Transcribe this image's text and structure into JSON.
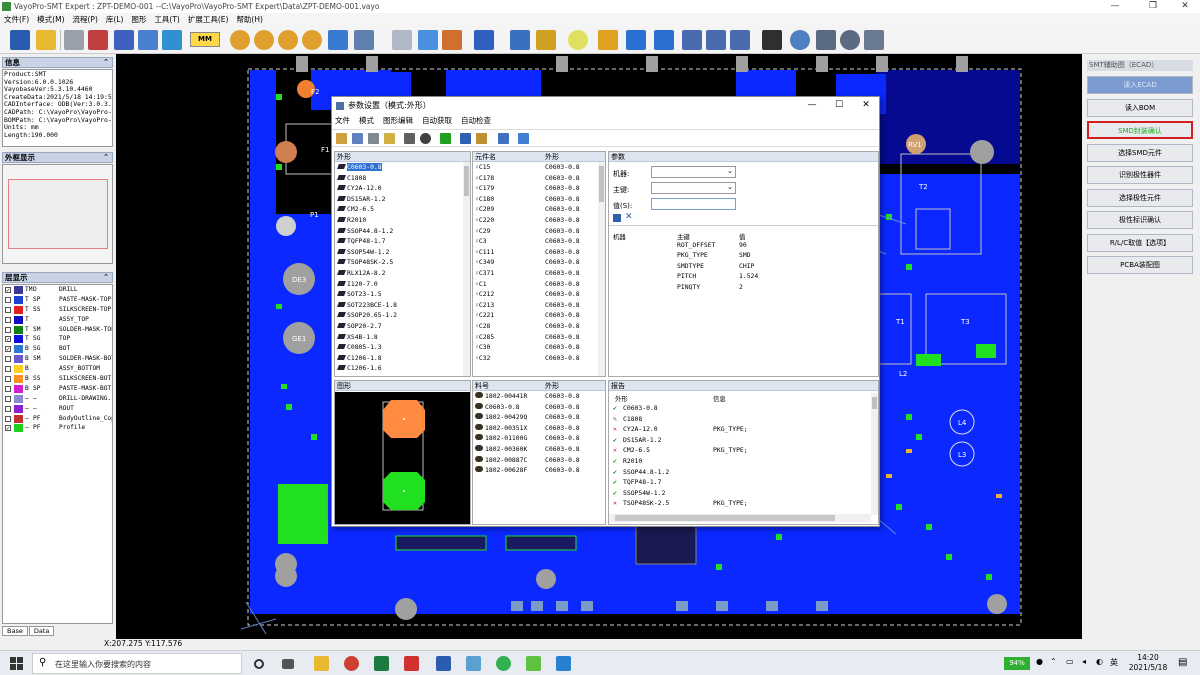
{
  "window": {
    "title": "VayoPro-SMT Expert : ZPT-DEMO-001 --C:\\VayoPro\\VayoPro-SMT Expert\\Data\\ZPT-DEMO-001.vayo"
  },
  "menu": [
    "文件(F)",
    "模式(M)",
    "流程(P)",
    "库(L)",
    "图形",
    "工具(T)",
    "扩展工具(E)",
    "帮助(H)"
  ],
  "toolbar": {
    "unit": "MM"
  },
  "info": {
    "title": "信息",
    "lines": [
      "Product:SMT",
      "Version:6.0.0.1026",
      "VayobaseVer:5.3.10.4460",
      "CreateData:2021/5/18 14:19:52",
      "CADInterface: ODB(Ver:3.0.3.1",
      "CADPath: C:\\VayoPro\\VayoPro-S",
      "BOMPath: C:\\VayoPro\\VayoPro-S",
      "Units: mm",
      "Length:190.000"
    ]
  },
  "overview": {
    "title": "外框显示"
  },
  "layers": {
    "title": "层显示",
    "rows": [
      {
        "on": true,
        "c1": "TM",
        "c2": "D",
        "name": "DRILL",
        "color": "#3a3a9a"
      },
      {
        "on": false,
        "c1": "T",
        "c2": "SP",
        "name": "PASTE-MASK-TOP",
        "color": "#2040d0"
      },
      {
        "on": false,
        "c1": "T",
        "c2": "SS",
        "name": "SILKSCREEN-TOP",
        "color": "#e02020"
      },
      {
        "on": false,
        "c1": "T",
        "c2": "",
        "name": "ASSY_TOP",
        "color": "#1010c0"
      },
      {
        "on": false,
        "c1": "T",
        "c2": "SM",
        "name": "SOLDER-MASK-TOP",
        "color": "#108010"
      },
      {
        "on": true,
        "c1": "T",
        "c2": "SG",
        "name": "TOP",
        "color": "#1010e0"
      },
      {
        "on": true,
        "c1": "B",
        "c2": "SG",
        "name": "BOT",
        "color": "#2a7ad0"
      },
      {
        "on": false,
        "c1": "B",
        "c2": "SM",
        "name": "SOLDER-MASK-BOT",
        "color": "#6a5acd"
      },
      {
        "on": false,
        "c1": "B",
        "c2": "",
        "name": "ASSY_BOTTOM",
        "color": "#ffd020"
      },
      {
        "on": false,
        "c1": "B",
        "c2": "SS",
        "name": "SILKSCREEN-BOT",
        "color": "#ff9020"
      },
      {
        "on": false,
        "c1": "B",
        "c2": "SP",
        "name": "PASTE-MASK-BOT",
        "color": "#d020d0"
      },
      {
        "on": false,
        "c1": "—",
        "c2": "—",
        "name": "DRILL-DRAWING.",
        "color": "#8a8ad0"
      },
      {
        "on": false,
        "c1": "—",
        "c2": "—",
        "name": "ROUT",
        "color": "#8a20d0"
      },
      {
        "on": false,
        "c1": "—",
        "c2": "PF",
        "name": "BodyOutline_Cop",
        "color": "#c03030"
      },
      {
        "on": true,
        "c1": "—",
        "c2": "PF",
        "name": "Profile",
        "color": "#20d020"
      }
    ]
  },
  "bottomTabs": [
    "Base",
    "Data"
  ],
  "status": {
    "coords": "X:207.275 Y:117.576"
  },
  "rightPanel": {
    "title": "SMT辅助图（ECAD）",
    "buttons": [
      "读入ECAD",
      "读入BOM",
      "SMD封装确认",
      "选择SMD元件",
      "识别极性器件",
      "选择极性元件",
      "极性标识确认",
      "R/L/C取值【选项】",
      "PCBA装配图"
    ],
    "active": 2
  },
  "dialog": {
    "title": "参数设置（模式:外形）",
    "menu": [
      "文件",
      "模式",
      "图形编辑",
      "自动获取",
      "自动检查"
    ],
    "shapeHeader": "外形",
    "shapes": [
      "C0603-0.8",
      "C1808",
      "CY2A-12.0",
      "DS15AR-1.2",
      "CM2-6.5",
      "R2010",
      "SSOP44.8-1.2",
      "TQFP48-1.7",
      "SSOP54W-1.2",
      "TSOP48SK-2.5",
      "RLX12A-8.2",
      "I120-7.0",
      "SOT23-1.5",
      "SOT223BCE-1.8",
      "SSOP20.65-1.2",
      "SOP20-2.7",
      "XS4B-1.8",
      "C0805-1.3",
      "C1206-1.8",
      "C1206-1.6"
    ],
    "compHeaders": [
      "元件名",
      "外形"
    ],
    "components": [
      [
        "C15",
        "C0603-0.8"
      ],
      [
        "C178",
        "C0603-0.8"
      ],
      [
        "C179",
        "C0603-0.8"
      ],
      [
        "C180",
        "C0603-0.8"
      ],
      [
        "C209",
        "C0603-0.8"
      ],
      [
        "C220",
        "C0603-0.8"
      ],
      [
        "C29",
        "C0603-0.8"
      ],
      [
        "C3",
        "C0603-0.8"
      ],
      [
        "C111",
        "C0603-0.8"
      ],
      [
        "C349",
        "C0603-0.8"
      ],
      [
        "C371",
        "C0603-0.8"
      ],
      [
        "C1",
        "C0603-0.8"
      ],
      [
        "C212",
        "C0603-0.8"
      ],
      [
        "C213",
        "C0603-0.8"
      ],
      [
        "C221",
        "C0603-0.8"
      ],
      [
        "C28",
        "C0603-0.8"
      ],
      [
        "C285",
        "C0603-0.8"
      ],
      [
        "C30",
        "C0603-0.8"
      ],
      [
        "C32",
        "C0603-0.8"
      ]
    ],
    "paramTitle": "参数",
    "paramLabels": [
      "机器:",
      "主键:",
      "值(S):"
    ],
    "paramHeaders": [
      "机器",
      "主键",
      "值"
    ],
    "params": [
      [
        "ROT_OFFSET",
        "90"
      ],
      [
        "PKG_TYPE",
        "SMD"
      ],
      [
        "SMDTYPE",
        "CHIP"
      ],
      [
        "PITCH",
        "1.524"
      ],
      [
        "PINQTY",
        "2"
      ]
    ],
    "graphicTitle": "图形",
    "partHeaders": [
      "料号",
      "外形"
    ],
    "parts": [
      [
        "1802-00441R",
        "C0603-0.8"
      ],
      [
        "C0603-0.8",
        "C0603-0.8"
      ],
      [
        "1802-00429Q",
        "C0603-0.8"
      ],
      [
        "1802-00351X",
        "C0603-0.8"
      ],
      [
        "1802-01100G",
        "C0603-0.8"
      ],
      [
        "1802-00360K",
        "C0603-0.8"
      ],
      [
        "1802-00887C",
        "C0603-0.8"
      ],
      [
        "1802-00628F",
        "C0603-0.8"
      ]
    ],
    "reportTitle": "报告",
    "reportHeaders": [
      "外形",
      "信息"
    ],
    "report": [
      [
        "ok",
        "C0603-0.8",
        ""
      ],
      [
        "pen",
        "C1808",
        ""
      ],
      [
        "err",
        "CY2A-12.0",
        "PKG_TYPE;"
      ],
      [
        "ok",
        "DS15AR-1.2",
        ""
      ],
      [
        "err",
        "CM2-6.5",
        "PKG_TYPE;"
      ],
      [
        "ok",
        "R2010",
        ""
      ],
      [
        "ok",
        "SSOP44.8-1.2",
        ""
      ],
      [
        "ok",
        "TQFP48-1.7",
        ""
      ],
      [
        "ok",
        "SSOP54W-1.2",
        ""
      ],
      [
        "err",
        "TSOP48SK-2.5",
        "PKG_TYPE;"
      ]
    ]
  },
  "taskbar": {
    "search": "在这里输入你要搜索的内容",
    "battery": "94%",
    "ime": "英",
    "time": "14:20",
    "date": "2021/5/18"
  },
  "pcbLabels": [
    "DE3",
    "GE1",
    "P1",
    "RV1",
    "T2",
    "T1",
    "T3",
    "L2",
    "L4",
    "L3",
    "F1",
    "F2"
  ]
}
